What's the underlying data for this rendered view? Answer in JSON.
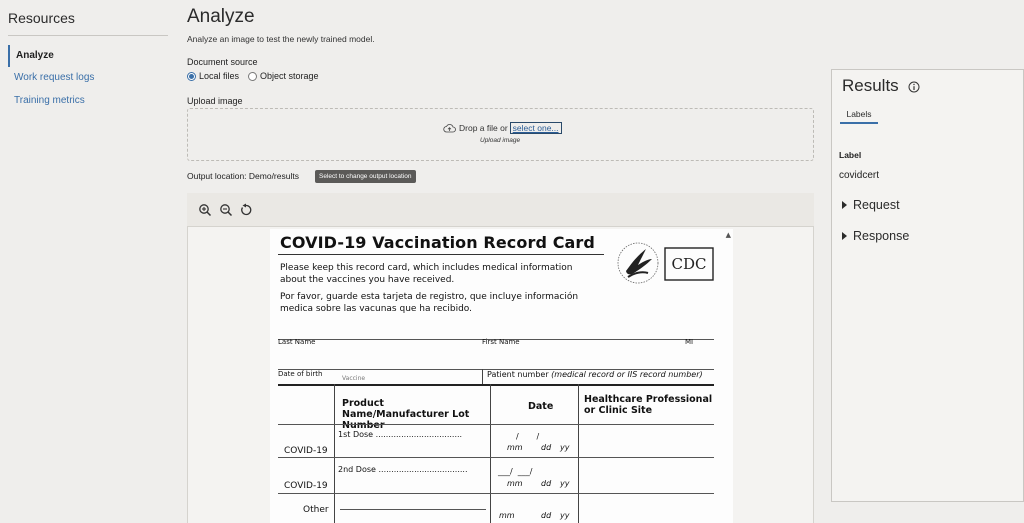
{
  "sidebar": {
    "title": "Resources",
    "items": [
      {
        "label": "Analyze",
        "active": true
      },
      {
        "label": "Work request logs",
        "active": false
      },
      {
        "label": "Training metrics",
        "active": false
      }
    ]
  },
  "main": {
    "title": "Analyze",
    "subtitle": "Analyze an image to test the newly trained model.",
    "document_source": {
      "label": "Document source",
      "options": [
        "Local files",
        "Object storage"
      ],
      "selected": "Local files"
    },
    "upload": {
      "label": "Upload image",
      "drop_text": "Drop a file or",
      "select_link": "select one...",
      "caption": "Upload image"
    },
    "output": {
      "label": "Output location: Demo/results",
      "button": "Select to change output location"
    },
    "toolbar": {
      "icons": [
        "zoom-in-icon",
        "zoom-out-icon",
        "reset-rotate-icon"
      ]
    }
  },
  "document": {
    "title": "COVID-19 Vaccination Record Card",
    "para_en": "Please keep this record card, which includes medical information about the vaccines you have received.",
    "para_es": "Por favor, guarde esta tarjeta de registro, que incluye información medica sobre las vacunas que ha recibido.",
    "logo_text": "CDC",
    "last_name": "Last Name",
    "first_name": "First Name",
    "mi": "MI",
    "dob": "Date of birth",
    "patient_number": "Patient number",
    "patient_number_note": "(medical record or IIS record number)",
    "col_vaccine": "Vaccine",
    "col_product": "Product Name/Manufacturer Lot Number",
    "col_date": "Date",
    "col_site": "Healthcare Professional or Clinic Site",
    "row1_vaccine": "COVID-19",
    "row1_dose": "1st Dose",
    "row2_vaccine": "COVID-19",
    "row2_dose": "2nd Dose",
    "row3_vaccine": "Other",
    "mm": "mm",
    "dd": "dd",
    "yy": "yy"
  },
  "results": {
    "title": "Results",
    "tab": "Labels",
    "label_heading": "Label",
    "label_value": "covidcert",
    "request": "Request",
    "response": "Response"
  }
}
